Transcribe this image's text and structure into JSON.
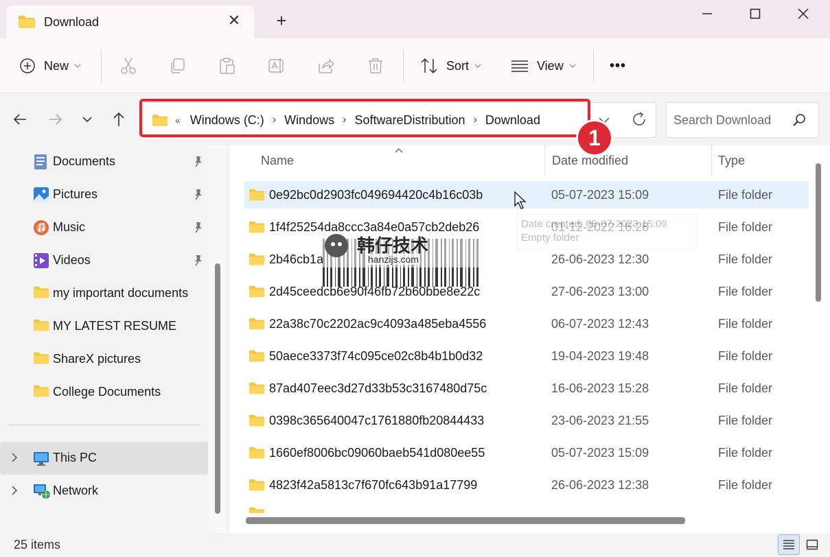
{
  "window": {
    "tab_title": "Download",
    "new_tab_symbol": "+",
    "tab_close_symbol": "✕"
  },
  "toolbar": {
    "new_label": "New",
    "sort_label": "Sort",
    "view_label": "View",
    "more_symbol": "•••"
  },
  "address": {
    "lead": "«",
    "crumbs": [
      "Windows (C:)",
      "Windows",
      "SoftwareDistribution",
      "Download"
    ],
    "annotation_number": "1"
  },
  "search": {
    "placeholder": "Search Download"
  },
  "sidebar": {
    "items": [
      {
        "label": "Documents",
        "icon": "documents-icon",
        "pinned": true
      },
      {
        "label": "Pictures",
        "icon": "pictures-icon",
        "pinned": true
      },
      {
        "label": "Music",
        "icon": "music-icon",
        "pinned": true
      },
      {
        "label": "Videos",
        "icon": "videos-icon",
        "pinned": true
      },
      {
        "label": "my important documents",
        "icon": "folder-icon",
        "pinned": false
      },
      {
        "label": "MY LATEST RESUME",
        "icon": "folder-icon",
        "pinned": false
      },
      {
        "label": "ShareX pictures",
        "icon": "folder-icon",
        "pinned": false
      },
      {
        "label": "College Documents",
        "icon": "folder-icon",
        "pinned": false
      }
    ],
    "this_pc": "This PC",
    "network": "Network"
  },
  "filelist": {
    "columns": {
      "name": "Name",
      "date": "Date modified",
      "type": "Type"
    },
    "rows": [
      {
        "name": "0e92bc0d2903fc049694420c4b16c03b",
        "date": "05-07-2023 15:09",
        "type": "File folder"
      },
      {
        "name": "1f4f25254da8ccc3a84e0a57cb2deb26",
        "date": "01-12-2022 16:28",
        "type": "File folder"
      },
      {
        "name": "2b46cb1a",
        "date": "26-06-2023 12:30",
        "type": "File folder"
      },
      {
        "name": "2d45ceedcb6e90f46fb72b60bbe8e22c",
        "date": "27-06-2023 13:00",
        "type": "File folder"
      },
      {
        "name": "22a38c70c2202ac9c4093a485eba4556",
        "date": "06-07-2023 12:43",
        "type": "File folder"
      },
      {
        "name": "50aece3373f74c095ce02c8b4b1b0d32",
        "date": "19-04-2023 19:48",
        "type": "File folder"
      },
      {
        "name": "87ad407eec3d27d33b53c3167480d75c",
        "date": "16-06-2023 15:28",
        "type": "File folder"
      },
      {
        "name": "0398c365640047c1761880fb20844433",
        "date": "23-06-2023 21:55",
        "type": "File folder"
      },
      {
        "name": "1660ef8006bc09060baeb541d080ee55",
        "date": "05-07-2023 15:09",
        "type": "File folder"
      },
      {
        "name": "4823f42a5813c7f670fc643b91a17799",
        "date": "26-06-2023 12:38",
        "type": "File folder"
      }
    ],
    "tooltip_line1": "Date created: 05-07-2023 15:09",
    "tooltip_line2": "Empty folder",
    "watermark_title": "韩仔技术",
    "watermark_url": "hanzijs.com"
  },
  "status": {
    "item_count": "25 items"
  }
}
